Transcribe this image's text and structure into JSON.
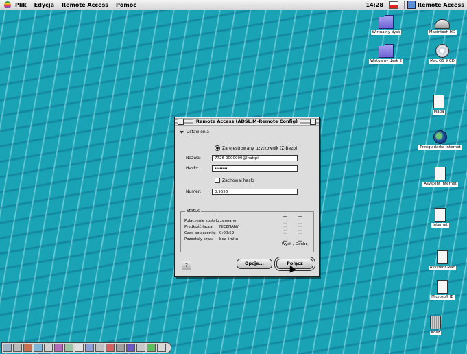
{
  "menubar": {
    "menus": [
      "Plik",
      "Edycja",
      "Remote Access",
      "Pomoc"
    ],
    "clock": "14:28",
    "app_name": "Remote Access"
  },
  "desktop_icons": [
    {
      "label": "Wirtualny dysk",
      "icon": "folder-icon"
    },
    {
      "label": "Macintosh HD",
      "icon": "disk-icon"
    },
    {
      "label": "Wirtualny dysk 2",
      "icon": "folder-icon"
    },
    {
      "label": "Mac OS 9 CD",
      "icon": "cd-icon"
    },
    {
      "label": "Mapa",
      "icon": "document-icon"
    },
    {
      "label": "Przeglądarka Internet",
      "icon": "globe-icon"
    },
    {
      "label": "Asystent Internet",
      "icon": "document-icon"
    },
    {
      "label": "Internet",
      "icon": "document-icon"
    },
    {
      "label": "Asystent Mac",
      "icon": "document-icon"
    },
    {
      "label": "Microsoft IE",
      "icon": "document-icon"
    },
    {
      "label": "Kosz",
      "icon": "trash-icon"
    }
  ],
  "dialog": {
    "title": "Remote Access (ADSL.M-Remote Config)",
    "section_label": "Ustawienia",
    "radio_label": "Zarejestrowany użytkownik (Z-Bezp)",
    "fields": {
      "name_label": "Nazwa:",
      "name_value": "7726-0000000@Ihattpl",
      "password_label": "Hasło:",
      "password_value": "••••••••",
      "save_password_label": "Zachowaj hasło",
      "number_label": "Numer:",
      "number_value": "0,9656"
    },
    "status": {
      "legend": "Status",
      "line1": "Połączenie zostało zerwane",
      "line2_label": "Prędkość łącza:",
      "line2_value": "NIEZNANY",
      "line3_label": "Czas połączenia:",
      "line3_value": "0:00:59",
      "line4_label": "Pozostały czas:",
      "line4_value": "bez limitu",
      "right_text": "Wysł. / Odebr."
    },
    "buttons": {
      "options": "Opcje...",
      "connect": "Połącz"
    },
    "help_glyph": "?"
  },
  "colors": {
    "desktop": "#1aa3b5",
    "window_bg": "#dddddd"
  }
}
